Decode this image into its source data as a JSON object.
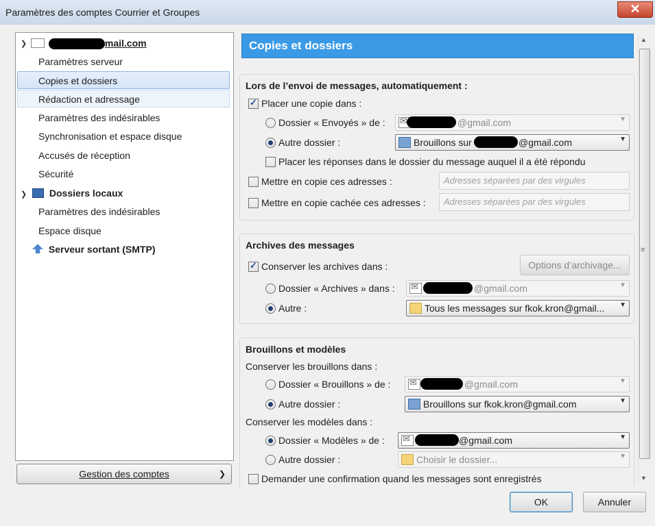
{
  "window": {
    "title": "Paramètres des comptes Courrier et Groupes",
    "close": "✕"
  },
  "tree": {
    "account_suffix": "mail.com",
    "items": [
      {
        "label": "Paramètres serveur"
      },
      {
        "label": "Copies et dossiers"
      },
      {
        "label": "Rédaction et adressage"
      },
      {
        "label": "Paramètres des indésirables"
      },
      {
        "label": "Synchronisation et espace disque"
      },
      {
        "label": "Accusés de réception"
      },
      {
        "label": "Sécurité"
      }
    ],
    "local_folders": "Dossiers locaux",
    "local_items": [
      {
        "label": "Paramètres des indésirables"
      },
      {
        "label": "Espace disque"
      }
    ],
    "smtp": "Serveur sortant (SMTP)"
  },
  "manage_accounts": "Gestion des comptes",
  "panel": {
    "title": "Copies et dossiers",
    "sending": {
      "title": "Lors de l’envoi de messages, automatiquement :",
      "place_copy": "Placer une copie dans :",
      "sent_folder": "Dossier « Envoyés » de :",
      "sent_folder_value": "@gmail.com",
      "other_folder": "Autre dossier :",
      "other_folder_prefix": "Brouillons sur",
      "other_folder_suffix": "@gmail.com",
      "replies": "Placer les réponses dans le dossier du message auquel il a été répondu",
      "cc": "Mettre en copie ces adresses :",
      "cc_placeholder": "Adresses séparées par des virgules",
      "bcc": "Mettre en copie cachée ces adresses :",
      "bcc_placeholder": "Adresses séparées par des virgules"
    },
    "archives": {
      "title": "Archives des messages",
      "keep": "Conserver les archives dans :",
      "options_button": "Options d’archivage...",
      "archives_folder": "Dossier « Archives » dans :",
      "archives_folder_value": "@gmail.com",
      "other": "Autre :",
      "other_value": "Tous les messages sur fkok.kron@gmail..."
    },
    "drafts": {
      "title": "Brouillons et modèles",
      "keep_drafts": "Conserver les brouillons dans :",
      "drafts_folder": "Dossier « Brouillons » de :",
      "drafts_folder_value": "@gmail.com",
      "drafts_other": "Autre dossier :",
      "drafts_other_value": "Brouillons sur fkok.kron@gmail.com",
      "keep_templates": "Conserver les modèles dans :",
      "templates_folder": "Dossier « Modèles » de :",
      "templates_folder_value": "@gmail.com",
      "templates_other": "Autre dossier :",
      "templates_other_value": "Choisir le dossier...",
      "confirm": "Demander une confirmation quand les messages sont enregistrés"
    }
  },
  "buttons": {
    "ok": "OK",
    "cancel": "Annuler"
  }
}
